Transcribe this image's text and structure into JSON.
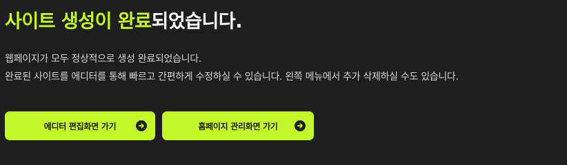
{
  "headline": {
    "accent_text": "사이트 생성이 완료",
    "rest_text": "되었습니다."
  },
  "description": {
    "line1": "웹페이지가 모두 정상적으로 생성 완료되었습니다.",
    "line2": "완료된 사이트를 에디터를 통해 빠르고 간편하게 수정하실 수 있습니다. 왼쪽 메뉴에서 추가 삭제하실 수도 있습니다."
  },
  "buttons": {
    "editor_label": "에디터 편집화면 가기",
    "admin_label": "홈페이지 관리화면 가기",
    "icon": "arrow-right-circle-icon"
  },
  "colors": {
    "accent": "#c5f82a",
    "background": "#1e1e1e",
    "text": "#ffffff"
  }
}
